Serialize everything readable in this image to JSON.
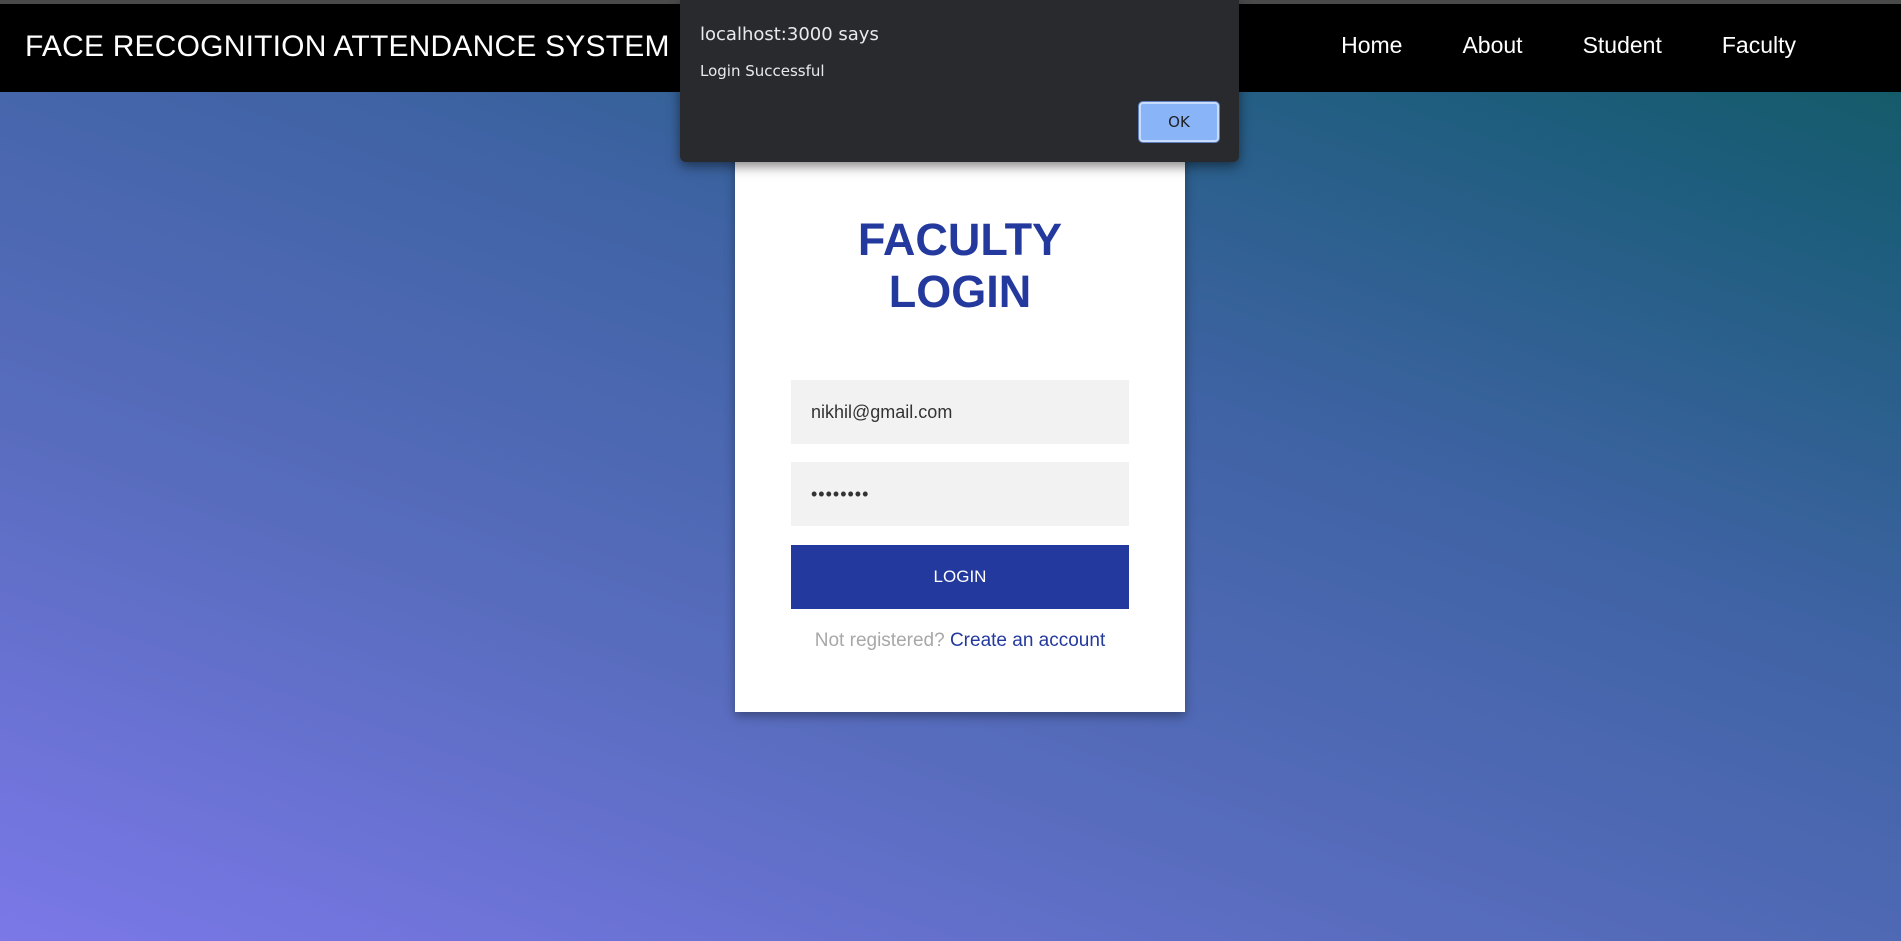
{
  "navbar": {
    "brand": "FACE RECOGNITION ATTENDANCE SYSTEM",
    "links": [
      "Home",
      "About",
      "Student",
      "Faculty"
    ]
  },
  "login_card": {
    "title_line1": "FACULTY",
    "title_line2": "LOGIN",
    "email_value": "nikhil@gmail.com",
    "password_value": "••••••••",
    "login_button": "LOGIN",
    "register_prompt": "Not registered?",
    "register_link": "Create an account"
  },
  "alert_dialog": {
    "title": "localhost:3000 says",
    "message": "Login Successful",
    "ok_button": "OK"
  },
  "colors": {
    "navbar_bg": "#000000",
    "accent": "#24399e",
    "dialog_bg": "#292a2d",
    "dialog_button": "#8ab4f8"
  }
}
